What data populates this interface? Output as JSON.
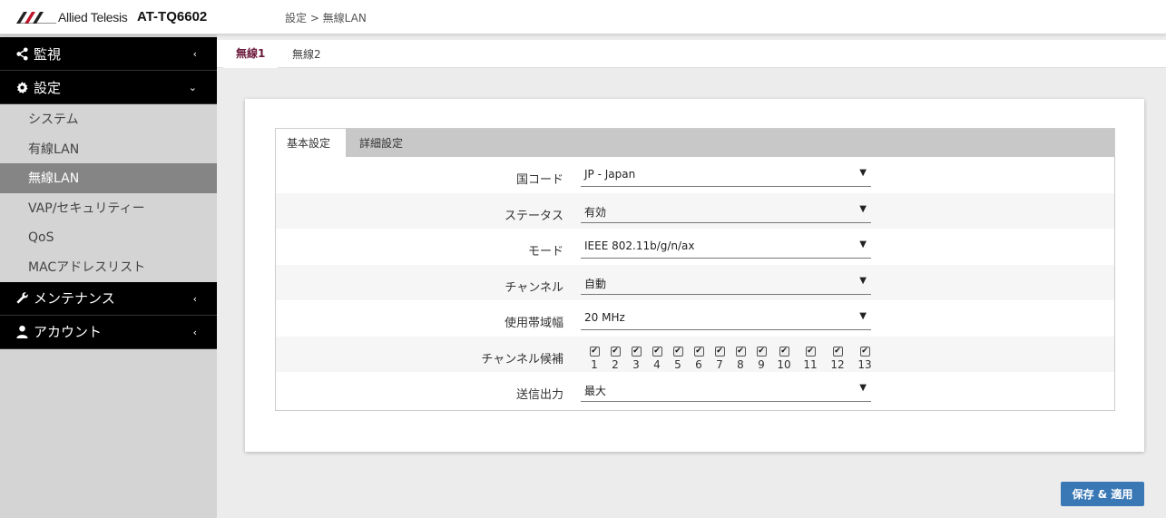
{
  "header": {
    "logo_text": "Allied Telesis",
    "model": "AT-TQ6602",
    "breadcrumb": "設定 > 無線LAN"
  },
  "sidebar": {
    "sections": [
      {
        "label": "監視",
        "icon": "share-icon",
        "chevron": "‹"
      },
      {
        "label": "設定",
        "icon": "gear-icon",
        "chevron": "⌄"
      }
    ],
    "items": [
      "システム",
      "有線LAN",
      "無線LAN",
      "VAP/セキュリティー",
      "QoS",
      "MACアドレスリスト"
    ],
    "active_item": "無線LAN",
    "sections2": [
      {
        "label": "メンテナンス",
        "icon": "wrench-icon",
        "chevron": "‹"
      },
      {
        "label": "アカウント",
        "icon": "user-icon",
        "chevron": "‹"
      }
    ]
  },
  "top_tabs": [
    "無線1",
    "無線2"
  ],
  "inner_tabs": [
    "基本設定",
    "詳細設定"
  ],
  "form": {
    "country_label": "国コード",
    "country_value": "JP - Japan",
    "status_label": "ステータス",
    "status_value": "有効",
    "mode_label": "モード",
    "mode_value": "IEEE 802.11b/g/n/ax",
    "channel_label": "チャンネル",
    "channel_value": "自動",
    "bandwidth_label": "使用帯域幅",
    "bandwidth_value": "20 MHz",
    "candidates_label": "チャンネル候補",
    "candidates": [
      "1",
      "2",
      "3",
      "4",
      "5",
      "6",
      "7",
      "8",
      "9",
      "10",
      "11",
      "12",
      "13"
    ],
    "power_label": "送信出力",
    "power_value": "最大"
  },
  "save_button": "保存 & 適用",
  "colors": {
    "accent": "#3a78b5",
    "active_tab": "#6b1a3b",
    "sidebar_dark": "#000000",
    "sidebar_active": "#858585"
  }
}
